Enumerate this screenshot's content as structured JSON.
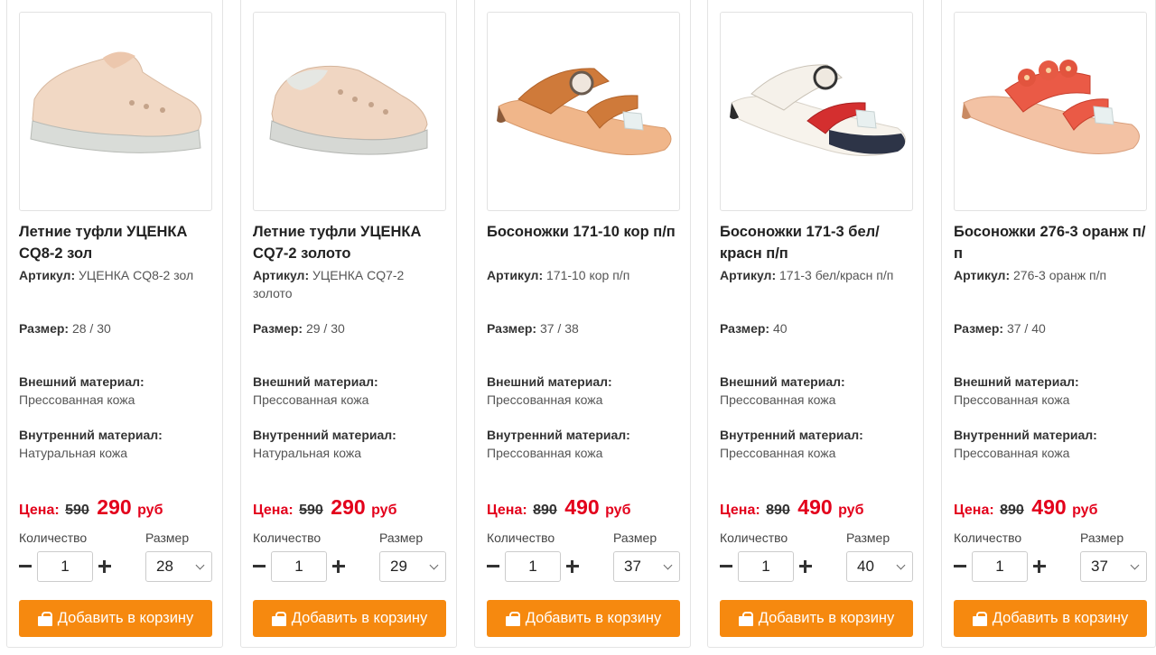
{
  "labels": {
    "article": "Артикул:",
    "size": "Размер:",
    "outer_material": "Внешний материал:",
    "inner_material": "Внутренний материал:",
    "price": "Цена:",
    "currency": "руб",
    "quantity": "Количество",
    "size_select": "Размер",
    "add_to_cart": "Добавить в корзину"
  },
  "colors": {
    "accent_button": "#f6890f",
    "price_red": "#e3001b"
  },
  "products": [
    {
      "title": "Летние туфли УЦЕНКА CQ8-2 зол",
      "article": "УЦЕНКА CQ8-2 зол",
      "size": "28 / 30",
      "outer_material": "Прессованная кожа",
      "inner_material": "Натуральная кожа",
      "old_price": "590",
      "price": "290",
      "quantity": "1",
      "selected_size": "28",
      "image_icon": "shoe-photo"
    },
    {
      "title": "Летние туфли УЦЕНКА CQ7-2 золото",
      "article": "УЦЕНКА CQ7-2 золото",
      "size": "29 / 30",
      "outer_material": "Прессованная кожа",
      "inner_material": "Натуральная кожа",
      "old_price": "590",
      "price": "290",
      "quantity": "1",
      "selected_size": "29",
      "image_icon": "shoe-photo"
    },
    {
      "title": "Босоножки 171-10 кор п/п",
      "article": "171-10 кор п/п",
      "size": "37 / 38",
      "outer_material": "Прессованная кожа",
      "inner_material": "Прессованная кожа",
      "old_price": "890",
      "price": "490",
      "quantity": "1",
      "selected_size": "37",
      "image_icon": "sandal-photo"
    },
    {
      "title": "Босоножки 171-3 бел/красн п/п",
      "article": "171-3 бел/красн п/п",
      "size": "40",
      "outer_material": "Прессованная кожа",
      "inner_material": "Прессованная кожа",
      "old_price": "890",
      "price": "490",
      "quantity": "1",
      "selected_size": "40",
      "image_icon": "sandal-photo"
    },
    {
      "title": "Босоножки 276-3 оранж п/п",
      "article": "276-3 оранж п/п",
      "size": "37 / 40",
      "outer_material": "Прессованная кожа",
      "inner_material": "Прессованная кожа",
      "old_price": "890",
      "price": "490",
      "quantity": "1",
      "selected_size": "37",
      "image_icon": "sandal-photo"
    }
  ]
}
